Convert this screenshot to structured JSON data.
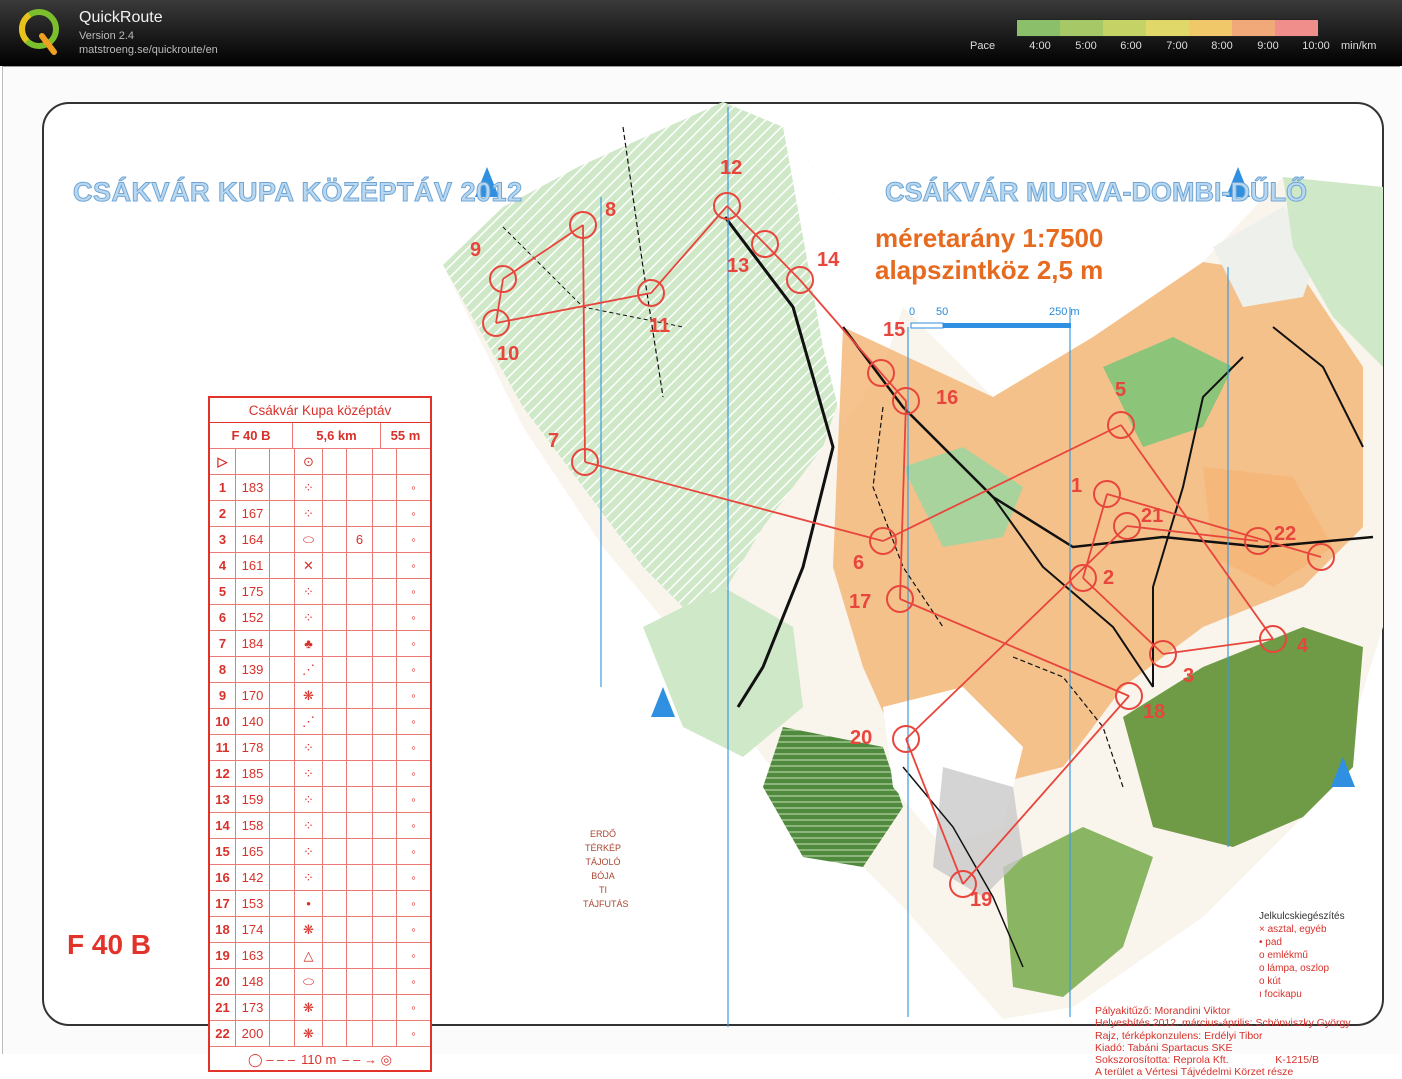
{
  "app": {
    "name": "QuickRoute",
    "version": "Version 2.4",
    "url": "matstroeng.se/quickroute/en"
  },
  "pace_scale": {
    "label": "Pace",
    "ticks": [
      "4:00",
      "5:00",
      "6:00",
      "7:00",
      "8:00",
      "9:00",
      "10:00"
    ],
    "unit": "min/km",
    "colors": [
      "#8cbf6a",
      "#a6c867",
      "#c4d266",
      "#e0d868",
      "#f0c869",
      "#f2a979",
      "#f08e8c"
    ]
  },
  "map": {
    "title_left": "CSÁKVÁR KUPA KÖZÉPTÁV 2012",
    "title_right": "CSÁKVÁR MURVA-DOMBI-DŰLŐ",
    "scale": "méretarány  1:7500",
    "contour": "alapszintköz  2,5 m",
    "scalebar_labels": [
      "0",
      "50",
      "250 m"
    ],
    "class_label": "F 40 B",
    "control_numbers": [
      "1",
      "2",
      "3",
      "4",
      "5",
      "6",
      "7",
      "8",
      "9",
      "10",
      "11",
      "12",
      "13",
      "14",
      "15",
      "16",
      "17",
      "18",
      "19",
      "20",
      "21",
      "22"
    ],
    "symbol_legend": [
      "ERDŐ",
      "TÉRKÉP",
      "TÁJOLÓ",
      "BÓJA",
      "TI",
      "TÁJFUTÁS"
    ],
    "legend_extra": {
      "title": "Jelkulcskiegészítés",
      "items": [
        "× asztal, egyéb",
        "• pad",
        "o emlékmű",
        "o lámpa, oszlop",
        "o kút",
        "ı focikapu"
      ]
    },
    "credits": {
      "course_setter": "Pályakitűző: Morandini Viktor",
      "update": "Helyesbítés 2012. március-április: Schönviszky György",
      "drawing": "Rajz, térképkonzulens: Erdélyi Tibor",
      "publisher": "Kiadó: Tabáni Spartacus SKE",
      "printer": "Sokszorosította: Reprola Kft.",
      "code": "K-1215/B",
      "area": "A terület a Vértesi Tájvédelmi Körzet része"
    }
  },
  "control_card": {
    "title": "Csákvár Kupa középtáv",
    "class": "F 40 B",
    "length": "5,6 km",
    "climb": "55 m",
    "rows": [
      {
        "n": "1",
        "code": "183"
      },
      {
        "n": "2",
        "code": "167"
      },
      {
        "n": "3",
        "code": "164",
        "extra": "6"
      },
      {
        "n": "4",
        "code": "161"
      },
      {
        "n": "5",
        "code": "175"
      },
      {
        "n": "6",
        "code": "152"
      },
      {
        "n": "7",
        "code": "184"
      },
      {
        "n": "8",
        "code": "139"
      },
      {
        "n": "9",
        "code": "170"
      },
      {
        "n": "10",
        "code": "140"
      },
      {
        "n": "11",
        "code": "178"
      },
      {
        "n": "12",
        "code": "185"
      },
      {
        "n": "13",
        "code": "159"
      },
      {
        "n": "14",
        "code": "158"
      },
      {
        "n": "15",
        "code": "165"
      },
      {
        "n": "16",
        "code": "142"
      },
      {
        "n": "17",
        "code": "153"
      },
      {
        "n": "18",
        "code": "174"
      },
      {
        "n": "19",
        "code": "163"
      },
      {
        "n": "20",
        "code": "148"
      },
      {
        "n": "21",
        "code": "173"
      },
      {
        "n": "22",
        "code": "200"
      }
    ],
    "finish": "110 m"
  }
}
